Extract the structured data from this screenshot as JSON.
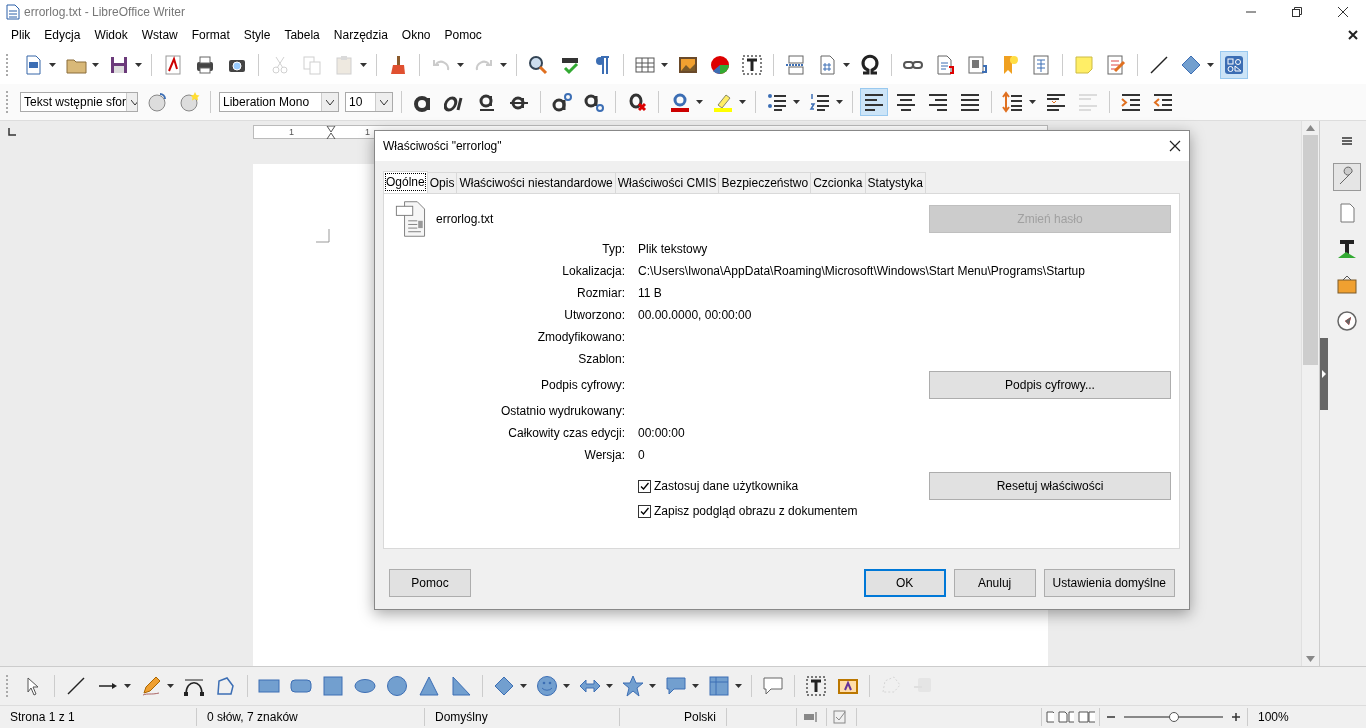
{
  "window": {
    "title": "errorlog.txt - LibreOffice Writer"
  },
  "menu": [
    {
      "label": "Plik"
    },
    {
      "label": "Edycja"
    },
    {
      "label": "Widok"
    },
    {
      "label": "Wstaw"
    },
    {
      "label": "Format"
    },
    {
      "label": "Style"
    },
    {
      "label": "Tabela"
    },
    {
      "label": "Narzędzia"
    },
    {
      "label": "Okno"
    },
    {
      "label": "Pomoc"
    }
  ],
  "standard_toolbar": {
    "clipboard_disabled": true,
    "undo_redo_disabled": true,
    "basic_shapes_selected": true
  },
  "formatting_toolbar": {
    "paragraph_style": "Tekst wstępnie sfor",
    "font_name": "Liberation Mono",
    "font_size": "10",
    "align_left_selected": true,
    "decrease_spacing_disabled": true
  },
  "ruler": {
    "labels": [
      "1",
      "1"
    ]
  },
  "sidebar": {
    "properties_selected": true
  },
  "dialog": {
    "title": "Właściwości \"errorlog\"",
    "tabs": [
      {
        "label": "Ogólne",
        "selected": true
      },
      {
        "label": "Opis",
        "selected": false
      },
      {
        "label": "Właściwości niestandardowe",
        "selected": false
      },
      {
        "label": "Właściwości CMIS",
        "selected": false
      },
      {
        "label": "Bezpieczeństwo",
        "selected": false
      },
      {
        "label": "Czcionka",
        "selected": false
      },
      {
        "label": "Statystyka",
        "selected": false
      }
    ],
    "file_name": "errorlog.txt",
    "change_password_button": {
      "label": "Zmień hasło",
      "disabled": true
    },
    "fields": [
      {
        "label": "Typ:",
        "value": "Plik tekstowy"
      },
      {
        "label": "Lokalizacja:",
        "value": "C:\\Users\\Iwona\\AppData\\Roaming\\Microsoft\\Windows\\Start Menu\\Programs\\Startup"
      },
      {
        "label": "Rozmiar:",
        "value": "11 B"
      },
      {
        "label": "Utworzono:",
        "value": "00.00.0000, 00:00:00"
      },
      {
        "label": "Zmodyfikowano:"
      },
      {
        "label": "Szablon:"
      },
      {
        "label": "Podpis cyfrowy:",
        "button": "Podpis cyfrowy..."
      },
      {
        "label": "Ostatnio wydrukowany:"
      },
      {
        "label": "Całkowity czas edycji:",
        "value": "00:00:00"
      },
      {
        "label": "Wersja:",
        "value": "0"
      }
    ],
    "checkboxes": [
      {
        "label": "Zastosuj dane użytkownika",
        "checked": true
      },
      {
        "label": "Zapisz podgląd obrazu z dokumentem",
        "checked": true
      }
    ],
    "reset_button": "Resetuj właściwości",
    "help_button": "Pomoc",
    "buttons": [
      {
        "label": "OK",
        "default": true
      },
      {
        "label": "Anuluj",
        "default": false
      },
      {
        "label": "Ustawienia domyślne",
        "default": false
      }
    ]
  },
  "status_bar": {
    "page": "Strona 1 z 1",
    "words": "0 słów, 7 znaków",
    "page_style": "Domyślny",
    "language": "Polski",
    "zoom": {
      "level": 0.5
    },
    "zoom_text": "100%"
  }
}
